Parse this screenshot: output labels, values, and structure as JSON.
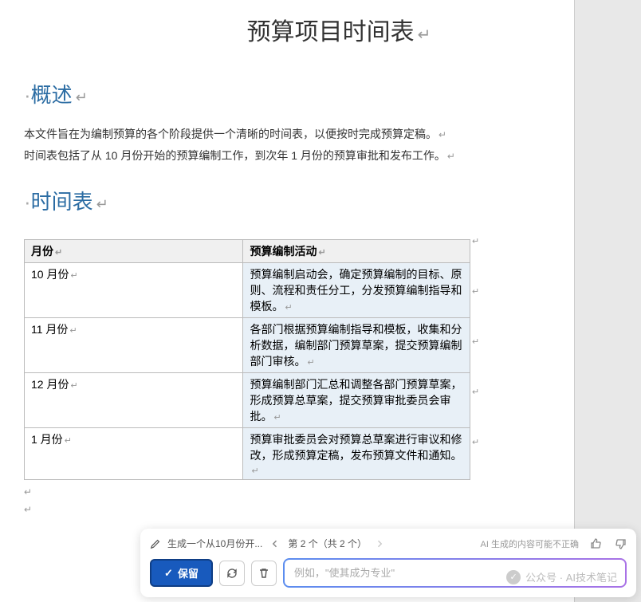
{
  "document": {
    "title": "预算项目时间表",
    "sections": {
      "overview": {
        "heading": "概述",
        "para1": "本文件旨在为编制预算的各个阶段提供一个清晰的时间表，以便按时完成预算定稿。",
        "para2": "时间表包括了从 10 月份开始的预算编制工作，到次年 1 月份的预算审批和发布工作。"
      },
      "schedule": {
        "heading": "时间表",
        "headers": {
          "month": "月份",
          "activity": "预算编制活动"
        },
        "rows": [
          {
            "month": "10 月份",
            "activity": "预算编制启动会，确定预算编制的目标、原则、流程和责任分工，分发预算编制指导和模板。"
          },
          {
            "month": "11 月份",
            "activity": "各部门根据预算编制指导和模板，收集和分析数据，编制部门预算草案，提交预算编制部门审核。"
          },
          {
            "month": "12 月份",
            "activity": "预算编制部门汇总和调整各部门预算草案，形成预算总草案，提交预算审批委员会审批。"
          },
          {
            "month": "1 月份",
            "activity": "预算审批委员会对预算总草案进行审议和修改，形成预算定稿，发布预算文件和通知。"
          }
        ]
      }
    }
  },
  "ai_bar": {
    "prompt_summary": "生成一个从10月份开...",
    "pager": "第 2 个（共 2 个）",
    "disclaimer": "AI 生成的内容可能不正确",
    "keep_label": "保留",
    "input_placeholder": "例如，\"使其成为专业\""
  },
  "watermark": {
    "text": "公众号 · AI技术笔记"
  }
}
